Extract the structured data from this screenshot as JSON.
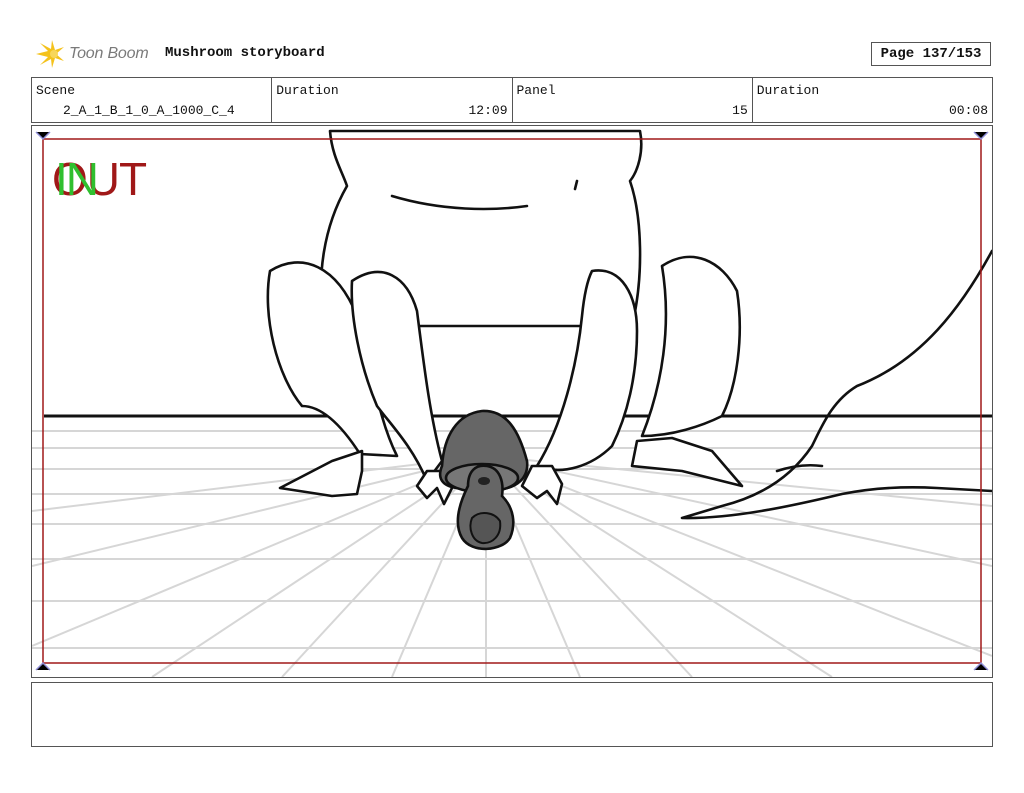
{
  "header": {
    "brand": "Toon Boom",
    "title": "Mushroom storyboard",
    "page": "Page 137/153"
  },
  "info": {
    "scene_label": "Scene",
    "scene_value": "2_A_1_B_1_0_A_1000_C_4",
    "duration_label": "Duration",
    "duration_value": "12:09",
    "panel_label": "Panel",
    "panel_value": "15",
    "panel_duration_label": "Duration",
    "panel_duration_value": "00:08"
  },
  "panel": {
    "out_text": "OUT",
    "in_text": "IN",
    "out_color": "#a01818",
    "in_color": "#2fbf2f",
    "frame_color": "#a01818",
    "mushroom_color": "#666666"
  },
  "notes": {
    "text": ""
  }
}
